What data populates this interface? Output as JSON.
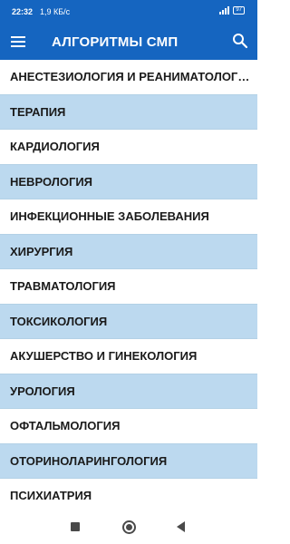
{
  "status_bar": {
    "time": "22:32",
    "speed": "1,9 КБ/с",
    "battery": "97"
  },
  "app_bar": {
    "title": "АЛГОРИТМЫ СМП",
    "menu_icon": "hamburger-menu-icon",
    "search_icon": "search-icon",
    "color": "#1565c0"
  },
  "list": {
    "items": [
      {
        "label": "АНЕСТЕЗИОЛОГИЯ И РЕАНИМАТОЛОГИЯ"
      },
      {
        "label": "ТЕРАПИЯ"
      },
      {
        "label": "КАРДИОЛОГИЯ"
      },
      {
        "label": "НЕВРОЛОГИЯ"
      },
      {
        "label": "ИНФЕКЦИОННЫЕ ЗАБОЛЕВАНИЯ"
      },
      {
        "label": "ХИРУРГИЯ"
      },
      {
        "label": "ТРАВМАТОЛОГИЯ"
      },
      {
        "label": "ТОКСИКОЛОГИЯ"
      },
      {
        "label": "АКУШЕРСТВО И ГИНЕКОЛОГИЯ"
      },
      {
        "label": "УРОЛОГИЯ"
      },
      {
        "label": "ОФТАЛЬМОЛОГИЯ"
      },
      {
        "label": "ОТОРИНОЛАРИНГОЛОГИЯ"
      },
      {
        "label": "ПСИХИАТРИЯ"
      }
    ],
    "stripe_color": "#bcd9ef"
  },
  "nav_bar": {
    "recent_icon": "recent-apps-icon",
    "home_icon": "home-icon",
    "back_icon": "back-icon"
  }
}
